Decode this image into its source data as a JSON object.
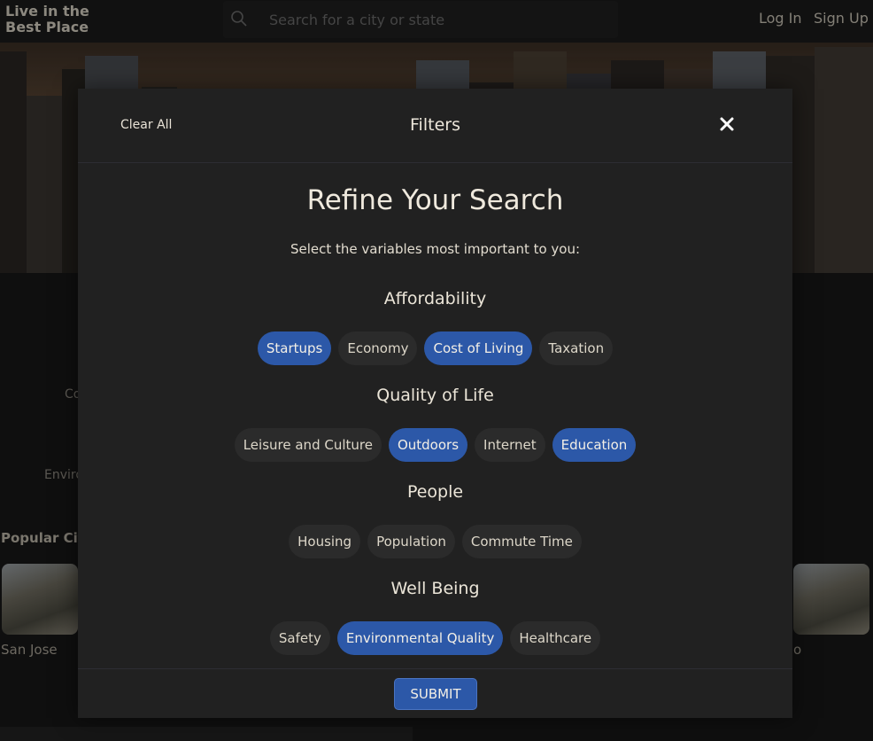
{
  "brand": {
    "line1": "Live in the",
    "line2": "Best Place"
  },
  "search": {
    "placeholder": "Search for a city or state"
  },
  "auth": {
    "login": "Log In",
    "signup": "Sign Up"
  },
  "background": {
    "fragment1": "Co",
    "fragment2": "Enviro",
    "popular_heading": "Popular Citi",
    "city_left": "San Jose",
    "city_right_fragment": "o"
  },
  "modal": {
    "clear_all": "Clear All",
    "title": "Filters",
    "close_symbol": "✕",
    "heading": "Refine Your Search",
    "subtitle": "Select the variables most important to you:",
    "submit": "SUBMIT",
    "selected_color": "#2c58a8",
    "groups": [
      {
        "title": "Affordability",
        "chips": [
          {
            "label": "Startups",
            "selected": true
          },
          {
            "label": "Economy",
            "selected": false
          },
          {
            "label": "Cost of Living",
            "selected": true
          },
          {
            "label": "Taxation",
            "selected": false
          }
        ]
      },
      {
        "title": "Quality of Life",
        "chips": [
          {
            "label": "Leisure and Culture",
            "selected": false
          },
          {
            "label": "Outdoors",
            "selected": true
          },
          {
            "label": "Internet",
            "selected": false
          },
          {
            "label": "Education",
            "selected": true
          }
        ]
      },
      {
        "title": "People",
        "chips": [
          {
            "label": "Housing",
            "selected": false
          },
          {
            "label": "Population",
            "selected": false
          },
          {
            "label": "Commute Time",
            "selected": false
          }
        ]
      },
      {
        "title": "Well Being",
        "chips": [
          {
            "label": "Safety",
            "selected": false
          },
          {
            "label": "Environmental Quality",
            "selected": true
          },
          {
            "label": "Healthcare",
            "selected": false
          }
        ]
      }
    ]
  }
}
